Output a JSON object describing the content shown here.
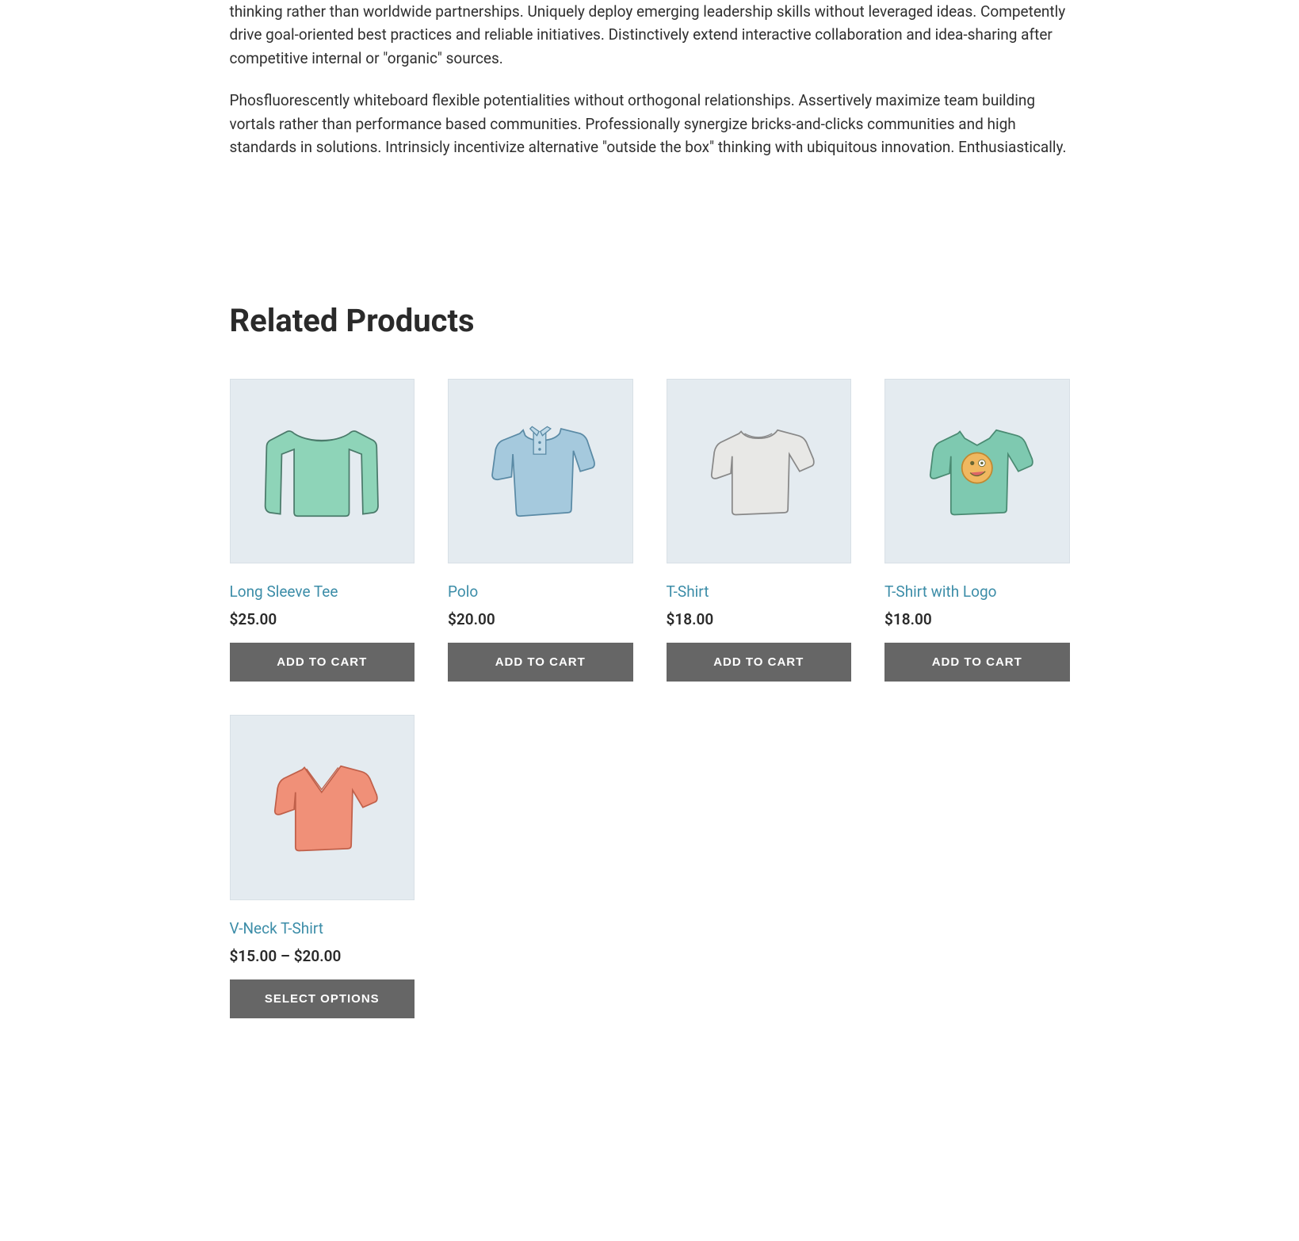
{
  "description": {
    "paragraph1": "thinking rather than worldwide partnerships. Uniquely deploy emerging leadership skills without leveraged ideas. Competently drive goal-oriented best practices and reliable initiatives. Distinctively extend interactive collaboration and idea-sharing after competitive internal or \"organic\" sources.",
    "paragraph2": "Phosfluorescently whiteboard flexible potentialities without orthogonal relationships. Assertively maximize team building vortals rather than performance based communities. Professionally synergize bricks-and-clicks communities and high standards in solutions. Intrinsicly incentivize alternative \"outside the box\" thinking with ubiquitous innovation. Enthusiastically."
  },
  "section_title": "Related Products",
  "products": [
    {
      "title": "Long Sleeve Tee",
      "price": "$25.00",
      "button_label": "ADD TO CART"
    },
    {
      "title": "Polo",
      "price": "$20.00",
      "button_label": "ADD TO CART"
    },
    {
      "title": "T-Shirt",
      "price": "$18.00",
      "button_label": "ADD TO CART"
    },
    {
      "title": "T-Shirt with Logo",
      "price": "$18.00",
      "button_label": "ADD TO CART"
    },
    {
      "title": "V-Neck T-Shirt",
      "price": "$15.00 – $20.00",
      "button_label": "SELECT OPTIONS"
    }
  ]
}
